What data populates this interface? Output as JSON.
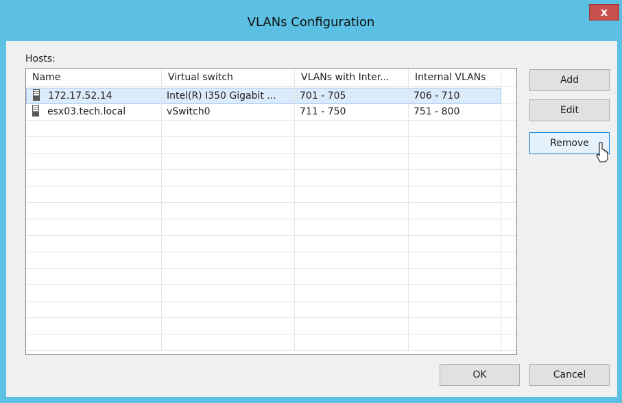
{
  "window": {
    "title": "VLANs Configuration",
    "close_label": "x"
  },
  "hosts_label": "Hosts:",
  "table": {
    "columns": [
      "Name",
      "Virtual switch",
      "VLANs with Inter...",
      "Internal VLANs"
    ],
    "rows": [
      {
        "name": "172.17.52.14",
        "switch": "Intel(R) I350 Gigabit ...",
        "vlans_ext": "701 - 705",
        "vlans_int": "706 - 710",
        "icon": "server-icon",
        "selected": true
      },
      {
        "name": "esx03.tech.local",
        "switch": "vSwitch0",
        "vlans_ext": "711 - 750",
        "vlans_int": "751 - 800",
        "icon": "server-icon",
        "selected": false
      }
    ]
  },
  "buttons": {
    "add": "Add",
    "edit": "Edit",
    "remove": "Remove",
    "ok": "OK",
    "cancel": "Cancel"
  },
  "colors": {
    "frame": "#5bc0e3",
    "close": "#c7504d",
    "selection": "#dcebfc",
    "hover_border": "#0078d7"
  }
}
